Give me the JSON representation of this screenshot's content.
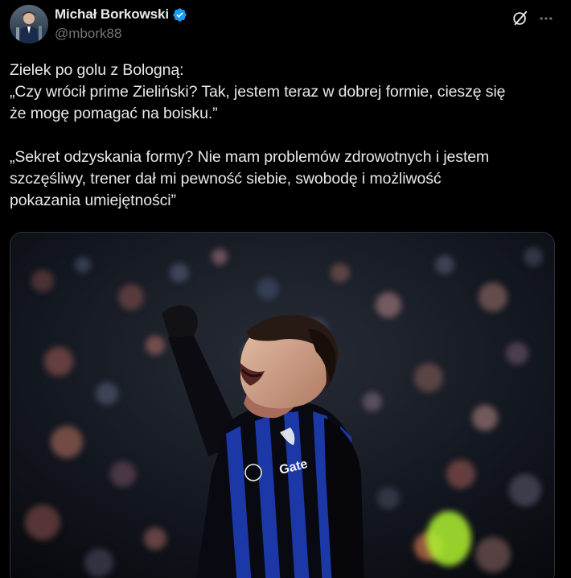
{
  "author": {
    "display_name": "Michał Borkowski",
    "handle": "@mbork88",
    "verified": true,
    "verified_color": "#1d9bf0"
  },
  "actions": {
    "grok_icon": "grok-icon",
    "more_icon": "more-horizontal-icon"
  },
  "tweet": {
    "paragraphs": [
      {
        "lines": [
          "Zielek po golu z Bologną:",
          "„Czy wrócił prime Zieliński? Tak, jestem teraz w dobrej formie, cieszę się",
          "że mogę pomagać na boisku.”"
        ]
      },
      {
        "lines": [
          "„Sekret odzyskania formy? Nie mam problemów zdrowotnych i jestem",
          "szczęśliwy, trener dał mi pewność siebie, swobodę i możliwość",
          "pokazania umiejętności”"
        ]
      }
    ]
  },
  "media": {
    "kit_sponsor_text": "Gate",
    "colors": {
      "background": "#000000",
      "text_primary": "#e7e9ea",
      "text_secondary": "#71767b",
      "kit_blue": "#1f3fb8",
      "kit_black": "#0a0a14"
    }
  }
}
